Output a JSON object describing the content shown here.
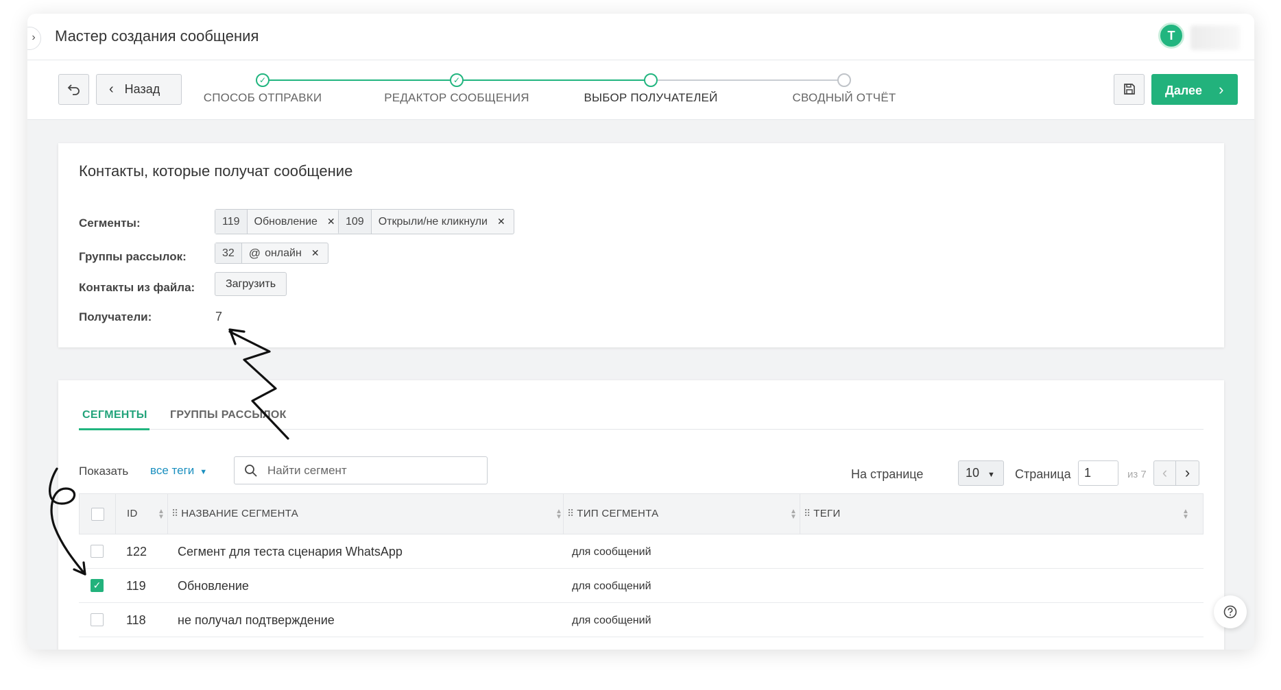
{
  "header": {
    "title": "Мастер создания сообщения",
    "avatar_initial": "T"
  },
  "wizard": {
    "back_label": "Назад",
    "next_label": "Далее",
    "steps": [
      {
        "label": "СПОСОБ ОТПРАВКИ",
        "state": "done"
      },
      {
        "label": "РЕДАКТОР СООБЩЕНИЯ",
        "state": "done"
      },
      {
        "label": "ВЫБОР ПОЛУЧАТЕЛЕЙ",
        "state": "current"
      },
      {
        "label": "СВОДНЫЙ ОТЧЁТ",
        "state": "future"
      }
    ]
  },
  "contacts": {
    "title": "Контакты, которые получат сообщение",
    "segments_label": "Сегменты:",
    "segments": [
      {
        "id": "119",
        "name": "Обновление"
      },
      {
        "id": "109",
        "name": "Открыли/не кликнули"
      }
    ],
    "groups_label": "Группы рассылок:",
    "groups": [
      {
        "id": "32",
        "name": "онлайн"
      }
    ],
    "file_label": "Контакты из файла:",
    "upload_label": "Загрузить",
    "recipients_label": "Получатели:",
    "recipients_value": "7"
  },
  "tabs": [
    {
      "label": "СЕГМЕНТЫ",
      "active": true
    },
    {
      "label": "ГРУППЫ РАССЫЛОК",
      "active": false
    }
  ],
  "filters": {
    "show_label": "Показать",
    "tags_value": "все теги",
    "search_placeholder": "Найти сегмент",
    "per_page_label": "На странице",
    "per_page_value": "10",
    "page_label": "Страница",
    "page_value": "1",
    "page_of": "из 7"
  },
  "table": {
    "columns": [
      "ID",
      "НАЗВАНИЕ СЕГМЕНТА",
      "ТИП СЕГМЕНТА",
      "ТЕГИ"
    ],
    "rows": [
      {
        "id": "122",
        "name": "Сегмент для теста сценария WhatsApp",
        "type": "для сообщений",
        "tags": "",
        "checked": false
      },
      {
        "id": "119",
        "name": "Обновление",
        "type": "для сообщений",
        "tags": "",
        "checked": true
      },
      {
        "id": "118",
        "name": "не получал подтверждение",
        "type": "для сообщений",
        "tags": "",
        "checked": false
      }
    ]
  },
  "colors": {
    "accent": "#22b27c",
    "link": "#1a8fbf",
    "background": "#f2f3f4"
  },
  "icons": [
    "undo-icon",
    "chevron-left-icon",
    "save-icon",
    "chevron-right-icon",
    "check-icon",
    "at-icon",
    "close-icon",
    "search-icon",
    "caret-down-icon",
    "sort-icon",
    "drag-handle-icon",
    "help-icon"
  ]
}
